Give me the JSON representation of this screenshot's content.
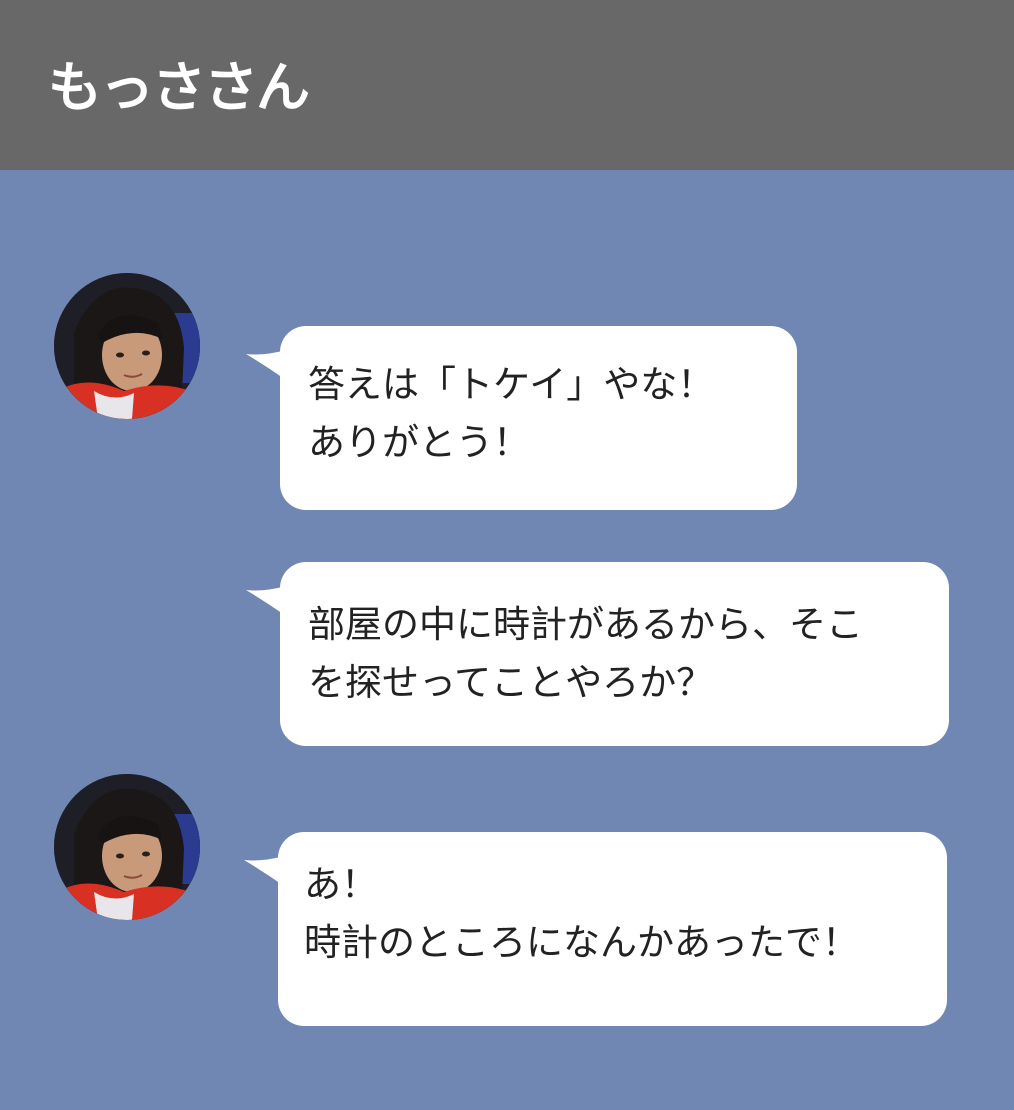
{
  "header": {
    "title": "もっささん"
  },
  "colors": {
    "header_bg": "#676867",
    "chat_bg": "#6f87b2",
    "bubble_bg": "#ffffff",
    "text": "#222222"
  },
  "messages": [
    {
      "sender_avatar": true,
      "lines": [
        "答えは「トケイ」やな！",
        "ありがとう！"
      ]
    },
    {
      "sender_avatar": false,
      "lines": [
        "部屋の中に時計があるから、そこ",
        "を探せってことやろか？"
      ]
    },
    {
      "sender_avatar": true,
      "lines": [
        "あ！",
        "時計のところになんかあったで！"
      ]
    }
  ]
}
